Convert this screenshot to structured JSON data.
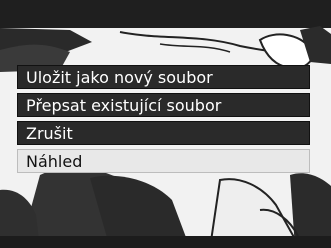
{
  "menu": {
    "items": [
      {
        "label": "Uložit jako nový soubor"
      },
      {
        "label": "Přepsat existující soubor"
      },
      {
        "label": "Zrušit"
      },
      {
        "label": "Náhled",
        "selected": true
      }
    ]
  },
  "colors": {
    "menu_bg": "#2a2a2a",
    "menu_text": "#ffffff",
    "selected_bg": "#e8e8e8",
    "selected_text": "#111111",
    "photo_dark": "#2c2c2c"
  }
}
